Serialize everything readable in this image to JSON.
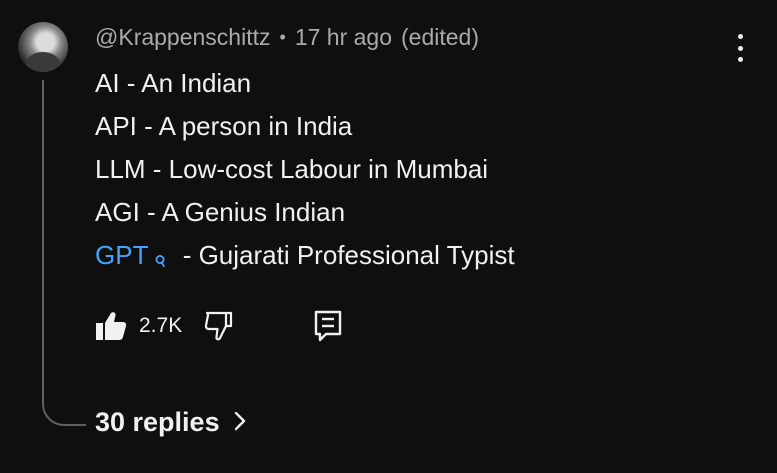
{
  "comment": {
    "author": "@Krappenschittz",
    "separator": "•",
    "timestamp": "17 hr ago",
    "edited": "(edited)",
    "lines": [
      {
        "text": "AI - An Indian"
      },
      {
        "text": "API - A person in India"
      },
      {
        "text": "LLM - Low-cost Labour in Mumbai"
      },
      {
        "text": "AGI - A Genius Indian"
      },
      {
        "link": "GPT",
        "text": "- Gujarati Professional Typist"
      }
    ],
    "actions": {
      "like_count": "2.7K"
    },
    "replies_label": "30 replies",
    "icons": {
      "avatar": "avatar",
      "like": "thumbs-up-icon",
      "dislike": "thumbs-down-icon",
      "reply": "reply-icon",
      "more": "more-vert-icon",
      "search": "search-icon",
      "chevron": "chevron-right-icon"
    },
    "colors": {
      "background": "#0f0f0f",
      "text": "#f1f1f1",
      "secondary_text": "#aaaaaa",
      "link": "#3ea6ff",
      "thread_line": "#5f5f5f"
    }
  }
}
